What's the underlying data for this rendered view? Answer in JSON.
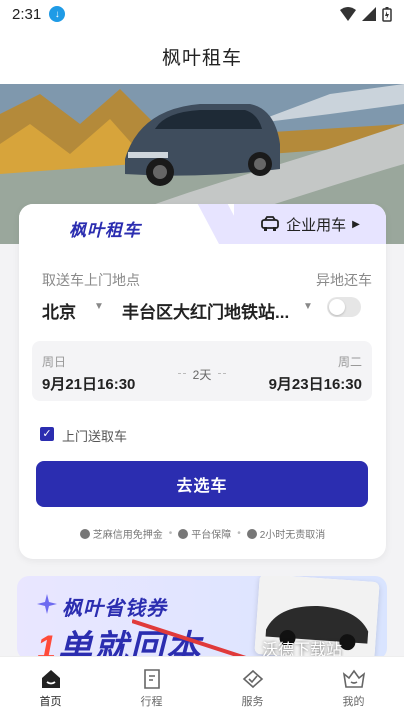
{
  "status_bar": {
    "time": "2:31"
  },
  "header": {
    "title": "枫叶租车"
  },
  "booking": {
    "brand_tab": "枫叶租车",
    "enterprise_tab": "企业用车",
    "pickup_label": "取送车上门地点",
    "return_label": "异地还车",
    "city": "北京",
    "address": "丰台区大红门地铁站...",
    "return_toggle_on": false,
    "start_day": "周日",
    "start_datetime": "9月21日16:30",
    "duration": "2天",
    "end_day": "周二",
    "end_datetime": "9月23日16:30",
    "delivery_checkbox_label": "上门送取车",
    "delivery_checked": true,
    "cta_label": "去选车",
    "features": [
      "芝麻信用免押金",
      "平台保障",
      "2小时无责取消"
    ]
  },
  "promo": {
    "title": "枫叶省钱券",
    "slogan_num": "1",
    "slogan_rest": "单就回本"
  },
  "watermark": "沃德下载站",
  "nav": {
    "items": [
      {
        "label": "首页",
        "icon": "home-icon",
        "active": true
      },
      {
        "label": "行程",
        "icon": "trip-icon",
        "active": false
      },
      {
        "label": "服务",
        "icon": "service-icon",
        "active": false
      },
      {
        "label": "我的",
        "icon": "profile-icon",
        "active": false
      }
    ]
  },
  "colors": {
    "primary": "#2b2db0",
    "tab_bg": "#e7e4ff",
    "promo_red": "#ff4b3a"
  }
}
